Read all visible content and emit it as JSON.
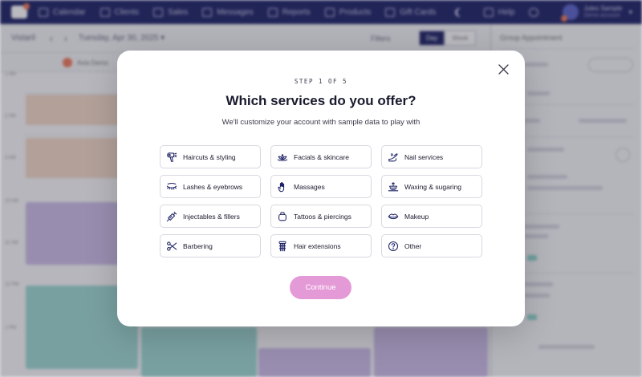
{
  "background": {
    "nav": [
      {
        "label": "Calendar"
      },
      {
        "label": "Clients"
      },
      {
        "label": "Sales"
      },
      {
        "label": "Messages"
      },
      {
        "label": "Reports"
      },
      {
        "label": "Products"
      },
      {
        "label": "Gift Cards"
      },
      {
        "label": "Help"
      }
    ],
    "user": {
      "name": "Jules Sample",
      "subtitle": "Demo account"
    },
    "toolbar": {
      "view_label": "Vistaril",
      "date": "Tuesday, Apr 30, 2025 ▾",
      "filters": "Filters",
      "seg_on": "Day",
      "seg_off": "Week"
    },
    "staff": "Avia Demo",
    "panel": {
      "title": "Group Appointment"
    },
    "times": [
      "1 AM",
      "2 AM",
      "3 AM",
      "10 AM",
      "11 AM",
      "12 PM",
      "1 PM"
    ]
  },
  "modal": {
    "step": "STEP 1 OF 5",
    "title": "Which services do you offer?",
    "subtitle": "We'll customize your account with sample data to play with",
    "services": [
      {
        "label": "Haircuts & styling",
        "icon": "hair-dryer-icon"
      },
      {
        "label": "Facials & skincare",
        "icon": "lotus-icon"
      },
      {
        "label": "Nail services",
        "icon": "nail-polish-icon"
      },
      {
        "label": "Lashes & eyebrows",
        "icon": "eyelash-icon"
      },
      {
        "label": "Massages",
        "icon": "hand-icon"
      },
      {
        "label": "Waxing & sugaring",
        "icon": "wax-icon"
      },
      {
        "label": "Injectables & fillers",
        "icon": "syringe-icon"
      },
      {
        "label": "Tattoos & piercings",
        "icon": "tattoo-machine-icon"
      },
      {
        "label": "Makeup",
        "icon": "lips-icon"
      },
      {
        "label": "Barbering",
        "icon": "scissors-icon"
      },
      {
        "label": "Hair extensions",
        "icon": "hair-extension-icon"
      },
      {
        "label": "Other",
        "icon": "question-circle-icon"
      }
    ],
    "continue_label": "Continue",
    "accent": "#e59ad8",
    "icon_color": "#1e2266"
  }
}
